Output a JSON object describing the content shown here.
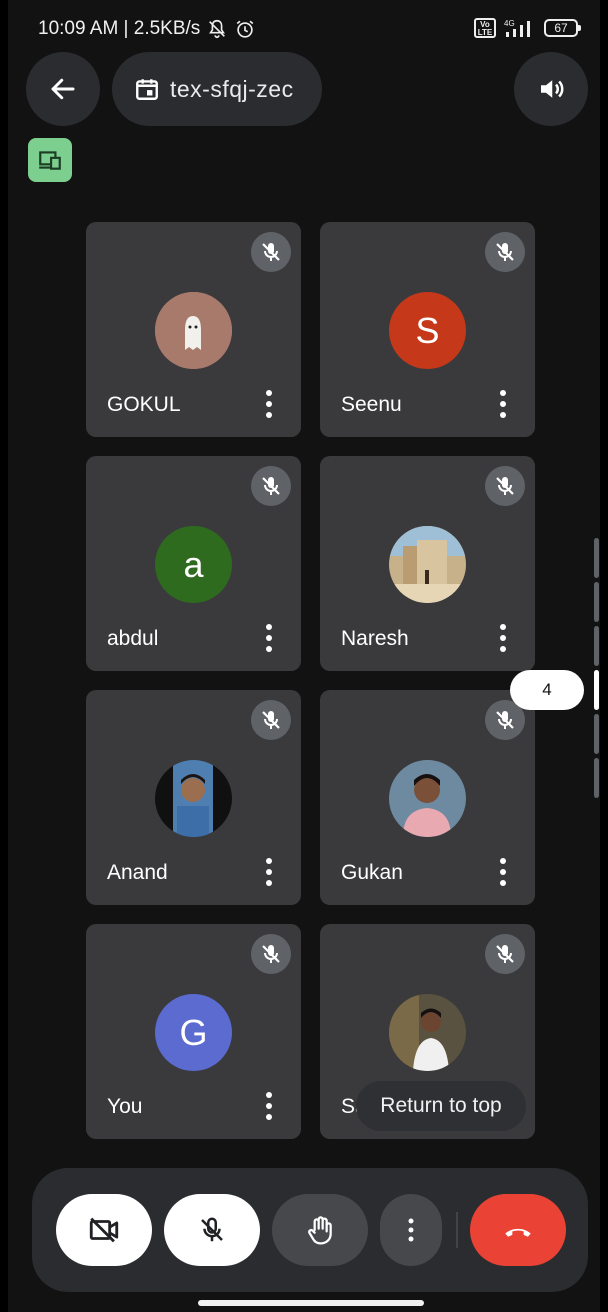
{
  "status_bar": {
    "time_speed": "10:09 AM | 2.5KB/s",
    "network": "4G",
    "volte": "Vo LTE",
    "battery": "67"
  },
  "header": {
    "meeting_code": "tex-sfqj-zec",
    "back_icon": "arrow-left-icon",
    "calendar_icon": "calendar-icon",
    "speaker_icon": "speaker-icon",
    "presenting_icon": "cast-device-icon"
  },
  "participants": [
    {
      "name": "GOKUL",
      "avatar_type": "photo",
      "muted": true
    },
    {
      "name": "Seenu",
      "avatar_letter": "S",
      "avatar_color": "#c5391a",
      "muted": true
    },
    {
      "name": "abdul",
      "avatar_letter": "a",
      "avatar_color": "#2e6b1f",
      "muted": true
    },
    {
      "name": "Naresh",
      "avatar_type": "photo",
      "muted": true
    },
    {
      "name": "Anand",
      "avatar_type": "photo",
      "muted": true
    },
    {
      "name": "Gukan",
      "avatar_type": "photo",
      "muted": true
    },
    {
      "name": "You",
      "avatar_letter": "G",
      "avatar_color": "#5b6bcf",
      "muted": true
    },
    {
      "name": "Sa",
      "avatar_type": "photo",
      "muted": true
    }
  ],
  "return_to_top": "Return to top",
  "page_indicator": "4",
  "controls": {
    "camera": "camera-off-icon",
    "mic": "mic-off-icon",
    "hand": "raise-hand-icon",
    "more": "more-vert-icon",
    "end_call": "end-call-icon",
    "end_call_color": "#ea4335"
  }
}
